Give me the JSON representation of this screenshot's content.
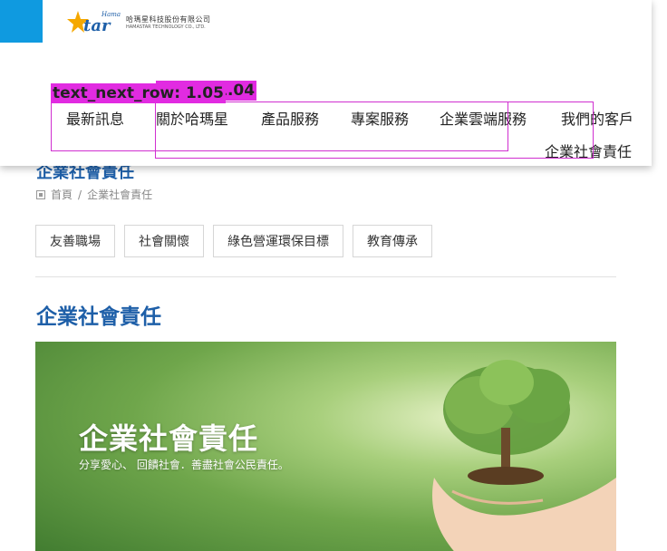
{
  "logo": {
    "cn": "哈瑪星科技股份有限公司",
    "en": "HAMASTAR TECHNOLOGY CO., LTD."
  },
  "nav": {
    "items": [
      "最新訊息",
      "關於哈瑪星",
      "產品服務",
      "專案服務",
      "企業雲端服務",
      "我們的客戶"
    ],
    "row2": "企業社會責任"
  },
  "debug": {
    "label_a": "text_next_row: 1.05",
    "label_b": "t_row: 1.04"
  },
  "page": {
    "title": "企業社會責任",
    "breadcrumb_home": "首頁",
    "breadcrumb_sep": "/",
    "breadcrumb_current": "企業社會責任"
  },
  "tabs": [
    "友善職場",
    "社會關懷",
    "綠色營運環保目標",
    "教育傳承"
  ],
  "section": {
    "title": "企業社會責任"
  },
  "banner": {
    "title": "企業社會責任",
    "subtitle": "分享愛心、 回饋社會．善盡社會公民責任。"
  },
  "colors": {
    "accent": "#0f9ae0",
    "title_blue": "#1e5fa8",
    "debug_magenta": "#e12be1"
  }
}
